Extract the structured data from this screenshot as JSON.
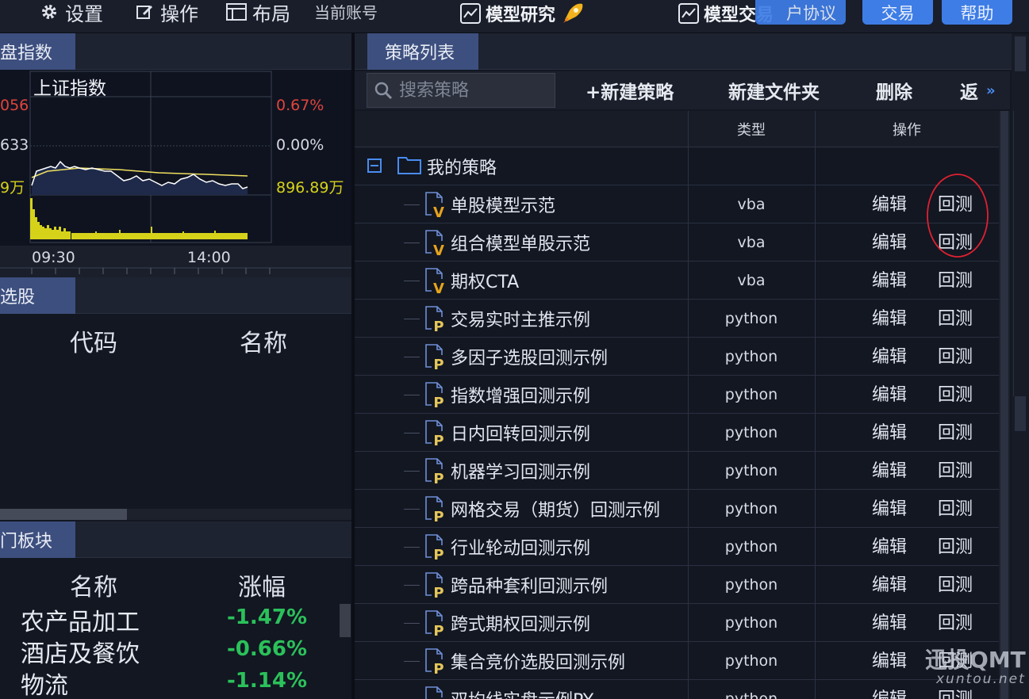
{
  "toolbar": {
    "settings_label": "设置",
    "operate_label": "操作",
    "layout_label": "布局",
    "account_label": "当前账号",
    "research_label": "模型研究",
    "trade_mode_label": "模型交易",
    "protocol_label": "户协议",
    "trade_btn": "交易",
    "help_btn": "帮助"
  },
  "index_panel": {
    "tab": "盘指数",
    "chart_title": "上证指数",
    "left_labels": [
      "056",
      "633",
      "9万"
    ],
    "right_labels": [
      "0.67%",
      "0.00%",
      "896.89万"
    ],
    "time_labels": [
      "09:30",
      "14:00"
    ]
  },
  "stock_panel": {
    "tab": "选股",
    "columns": [
      "代码",
      "名称"
    ]
  },
  "sector_panel": {
    "tab": "门板块",
    "columns": [
      "名称",
      "涨幅"
    ],
    "rows": [
      {
        "name": "农产品加工",
        "change": "-1.47%"
      },
      {
        "name": "酒店及餐饮",
        "change": "-0.66%"
      },
      {
        "name": "物流",
        "change": "-1.14%"
      }
    ]
  },
  "strategy_panel": {
    "tab": "策略列表",
    "search_placeholder": "搜索策略",
    "new_strategy": "+新建策略",
    "new_folder": "新建文件夹",
    "delete": "删除",
    "back": "返",
    "col_type": "类型",
    "col_action": "操作",
    "folder_name": "我的策略",
    "edit_label": "编辑",
    "backtest_label": "回测",
    "rows": [
      {
        "name": "单股模型示范",
        "type": "vba",
        "icon": "V"
      },
      {
        "name": "组合模型单股示范",
        "type": "vba",
        "icon": "V"
      },
      {
        "name": "期权CTA",
        "type": "vba",
        "icon": "V"
      },
      {
        "name": "交易实时主推示例",
        "type": "python",
        "icon": "P"
      },
      {
        "name": "多因子选股回测示例",
        "type": "python",
        "icon": "P"
      },
      {
        "name": "指数增强回测示例",
        "type": "python",
        "icon": "P"
      },
      {
        "name": "日内回转回测示例",
        "type": "python",
        "icon": "P"
      },
      {
        "name": "机器学习回测示例",
        "type": "python",
        "icon": "P"
      },
      {
        "name": "网格交易（期货）回测示例",
        "type": "python",
        "icon": "P"
      },
      {
        "name": "行业轮动回测示例",
        "type": "python",
        "icon": "P"
      },
      {
        "name": "跨品种套利回测示例",
        "type": "python",
        "icon": "P"
      },
      {
        "name": "跨式期权回测示例",
        "type": "python",
        "icon": "P"
      },
      {
        "name": "集合竞价选股回测示例",
        "type": "python",
        "icon": "P"
      },
      {
        "name": "双均线实盘示例PY",
        "type": "python",
        "icon": "P"
      }
    ]
  },
  "watermark": {
    "brand": "迅投QMT",
    "site": "xuntou.net"
  },
  "colors": {
    "accent": "#3e7de6",
    "tab": "#3d4f7e",
    "down": "#2bc15a",
    "up": "#e0443c",
    "volume": "#d6d21a",
    "circle": "#e02030"
  }
}
